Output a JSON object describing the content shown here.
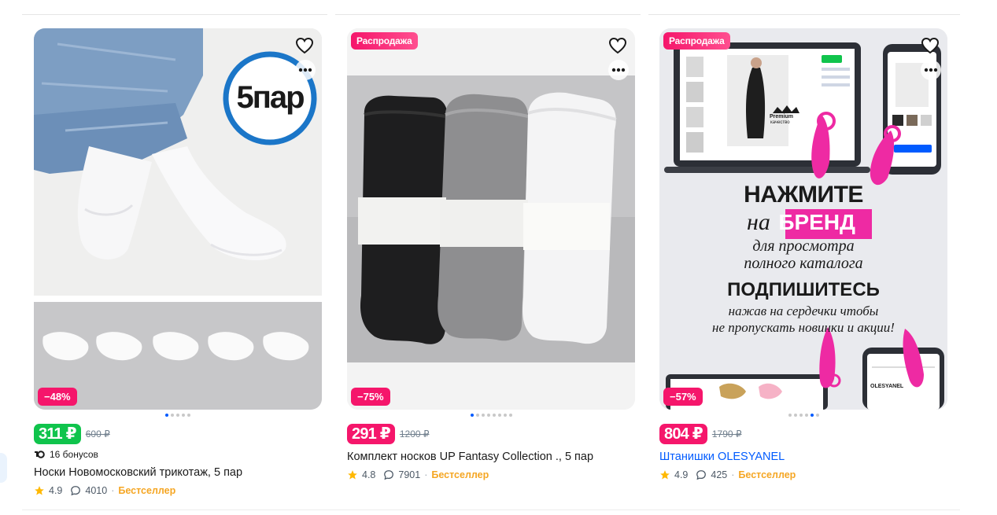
{
  "products": [
    {
      "sale_tag": "",
      "image_badge": "5пар",
      "discount": "−48%",
      "price": "311 ₽",
      "old_price": "600 ₽",
      "bonus": "16 бонусов",
      "title": "Носки Новомосковский трикотаж, 5 пар",
      "rating": "4.9",
      "reviews": "4010",
      "badge": "Бестселлер",
      "dots_active": 0
    },
    {
      "sale_tag": "Распродажа",
      "discount": "−75%",
      "price": "291 ₽",
      "old_price": "1200 ₽",
      "title": "Комплект носков UP Fantasy Collection ., 5 пар",
      "rating": "4.8",
      "reviews": "7901",
      "badge": "Бестселлер",
      "dots_active": 0
    },
    {
      "sale_tag": "Распродажа",
      "discount": "−57%",
      "price": "804 ₽",
      "old_price": "1790 ₽",
      "title": "Штанишки OLESYANEL",
      "rating": "4.9",
      "reviews": "425",
      "badge": "Бестселлер",
      "dots_active": 4,
      "promo": {
        "line1": "НАЖМИТЕ",
        "line2a": "на",
        "line2b": "БРЕНД",
        "line3": "для просмотра",
        "line4": "полного каталога",
        "line5": "ПОДПИШИТЕСЬ",
        "line6": "нажав на сердечки чтобы",
        "line7": "не пропускать новинки и акции!",
        "premium": "Premium",
        "premium_sub": "качество",
        "brand": "OLESYANEL"
      }
    }
  ],
  "colors": {
    "accent": "#005bff",
    "sale": "#f5166b",
    "green_price": "#10c44c",
    "bestseller": "#f5a623"
  },
  "icons": {
    "favorite": "heart-icon",
    "more": "more-dots-icon",
    "rating": "star-icon",
    "reviews": "comment-icon",
    "bonus": "bonus-icon"
  }
}
